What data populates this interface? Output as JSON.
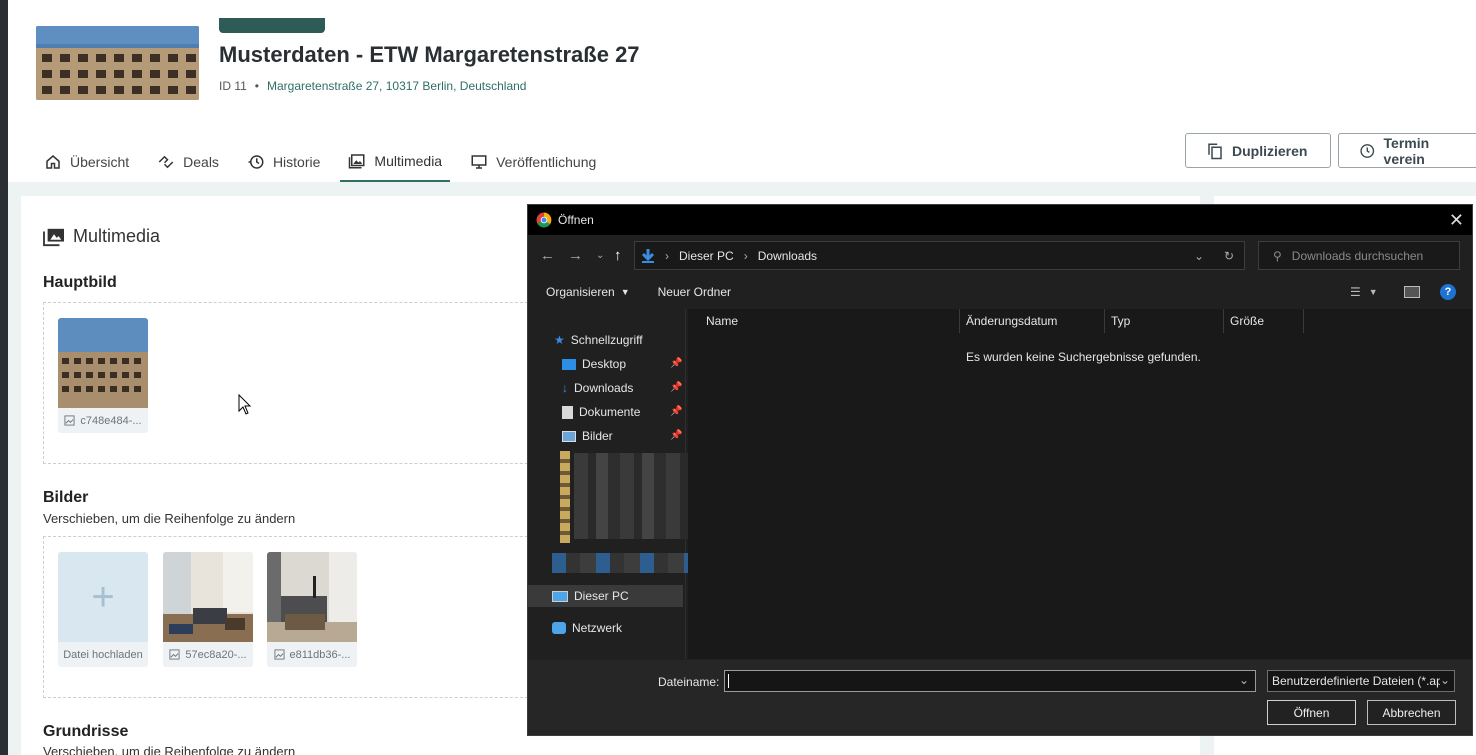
{
  "header": {
    "title": "Musterdaten - ETW Margaretenstraße 27",
    "id_label": "ID 11",
    "address": "Margaretenstraße 27, 10317 Berlin, Deutschland"
  },
  "tabs": [
    {
      "label": "Übersicht",
      "icon": "home-icon"
    },
    {
      "label": "Deals",
      "icon": "handshake-icon"
    },
    {
      "label": "Historie",
      "icon": "history-icon"
    },
    {
      "label": "Multimedia",
      "icon": "images-icon",
      "active": true
    },
    {
      "label": "Veröffentlichung",
      "icon": "monitor-icon"
    }
  ],
  "actions": {
    "duplicate": "Duplizieren",
    "schedule": "Termin verein"
  },
  "main": {
    "section_title": "Multimedia",
    "hauptbild": {
      "label": "Hauptbild",
      "file": "c748e484-..."
    },
    "bilder": {
      "label": "Bilder",
      "hint": "Verschieben, um die Reihenfolge zu ändern",
      "upload_label": "Datei hochladen",
      "files": [
        "57ec8a20-...",
        "e811db36-..."
      ]
    },
    "grundrisse": {
      "label": "Grundrisse",
      "hint": "Verschieben, um die Reihenfolge zu ändern"
    }
  },
  "dialog": {
    "title": "Öffnen",
    "path": [
      "Dieser PC",
      "Downloads"
    ],
    "search_placeholder": "Downloads durchsuchen",
    "organize": "Organisieren",
    "new_folder": "Neuer Ordner",
    "columns": [
      "Name",
      "Änderungsdatum",
      "Typ",
      "Größe"
    ],
    "empty_message": "Es wurden keine Suchergebnisse gefunden.",
    "nav": {
      "quick_access": "Schnellzugriff",
      "items": [
        "Desktop",
        "Downloads",
        "Dokumente",
        "Bilder"
      ],
      "this_pc": "Dieser PC",
      "network": "Netzwerk"
    },
    "filename_label": "Dateiname:",
    "filename_value": "",
    "filetype": "Benutzerdefinierte Dateien (*.ap",
    "open_button": "Öffnen",
    "cancel_button": "Abbrechen"
  }
}
